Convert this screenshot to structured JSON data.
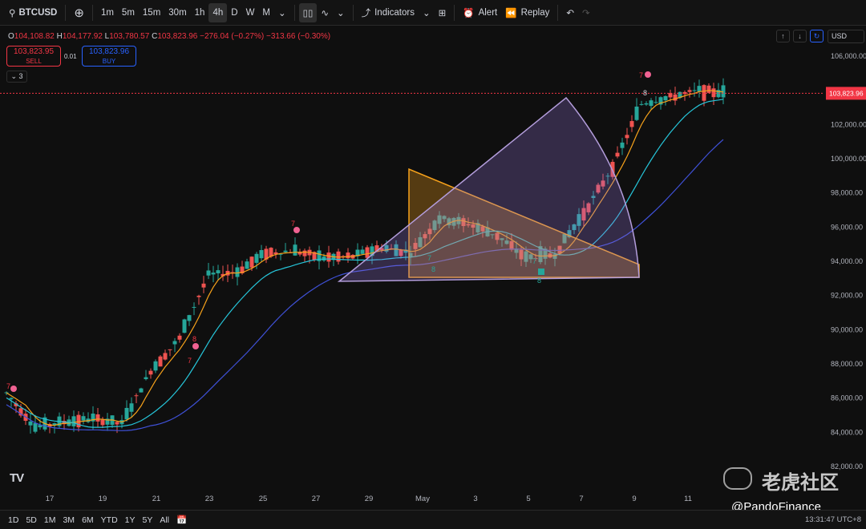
{
  "toolbar": {
    "symbol": "BTCUSD",
    "intervals": [
      "1m",
      "5m",
      "15m",
      "30m",
      "1h",
      "4h",
      "D",
      "W",
      "M"
    ],
    "active_interval": "4h",
    "indicators_label": "Indicators",
    "alert_label": "Alert",
    "replay_label": "Replay"
  },
  "ohlc": {
    "o": "104,108.82",
    "h": "104,177.92",
    "l": "103,780.57",
    "c": "103,823.96",
    "change": "−276.04 (−0.27%)",
    "change2": "−313.66 (−0.30%)"
  },
  "trade": {
    "sell_price": "103,823.95",
    "sell_label": "SELL",
    "spread": "0.01",
    "buy_price": "103,823.96",
    "buy_label": "BUY"
  },
  "collapse_count": "3",
  "currency": "USD",
  "price_axis": {
    "ticks": [
      "106,000.00",
      "104,000.00",
      "102,000.00",
      "100,000.00",
      "98,000.00",
      "96,000.00",
      "94,000.00",
      "92,000.00",
      "90,000.00",
      "88,000.00",
      "86,000.00",
      "84,000.00",
      "82,000.00"
    ],
    "current_price_label": "103,823.96",
    "current_price_color": "#f23645"
  },
  "time_axis": {
    "ticks": [
      "17",
      "19",
      "21",
      "23",
      "25",
      "27",
      "29",
      "May",
      "3",
      "5",
      "7",
      "9",
      "11"
    ]
  },
  "markers": {
    "left_top": "7",
    "apr21": "8",
    "apr21b": "7",
    "apr26": "7",
    "apr30_a": "7",
    "apr30_b": "8",
    "may5_a": "7",
    "may5_b": "8",
    "may9_a": "7",
    "may9_b": "8"
  },
  "bottom": {
    "ranges": [
      "1D",
      "5D",
      "1M",
      "3M",
      "6M",
      "YTD",
      "1Y",
      "5Y",
      "All"
    ],
    "clock": "13:31:47 UTC+8"
  },
  "watermark": {
    "cn_text": "老虎社区",
    "handle": "@PandoFinance"
  },
  "colors": {
    "up": "#26a69a",
    "down": "#ef5350",
    "ema_fast": "#f7a21b",
    "ema_mid": "#26c6da",
    "ema_slow": "#3f51d8",
    "triangle": "#f7a21b",
    "fan": "#b39ddb"
  },
  "chart_data": {
    "type": "candlestick",
    "symbol": "BTCUSD",
    "interval": "4h",
    "ylim": [
      82000,
      106000
    ],
    "x_labels": [
      "17",
      "19",
      "21",
      "23",
      "25",
      "27",
      "29",
      "May",
      "3",
      "5",
      "7",
      "9",
      "11"
    ],
    "close_path": [
      {
        "x": "16",
        "y": 86300
      },
      {
        "x": "17",
        "y": 84300
      },
      {
        "x": "18",
        "y": 84600
      },
      {
        "x": "19",
        "y": 84800
      },
      {
        "x": "20",
        "y": 84500
      },
      {
        "x": "21",
        "y": 87600
      },
      {
        "x": "22",
        "y": 89500
      },
      {
        "x": "23",
        "y": 93200
      },
      {
        "x": "24",
        "y": 93400
      },
      {
        "x": "25",
        "y": 94500
      },
      {
        "x": "26",
        "y": 94600
      },
      {
        "x": "27",
        "y": 94200
      },
      {
        "x": "28",
        "y": 94300
      },
      {
        "x": "29",
        "y": 94800
      },
      {
        "x": "30",
        "y": 94500
      },
      {
        "x": "May",
        "y": 96500
      },
      {
        "x": "3",
        "y": 96200
      },
      {
        "x": "4",
        "y": 95500
      },
      {
        "x": "5",
        "y": 94200
      },
      {
        "x": "6",
        "y": 94400
      },
      {
        "x": "7",
        "y": 96800
      },
      {
        "x": "8",
        "y": 99500
      },
      {
        "x": "9",
        "y": 103200
      },
      {
        "x": "10",
        "y": 103600
      },
      {
        "x": "11",
        "y": 104000
      },
      {
        "x": "12",
        "y": 103824
      }
    ],
    "last_price": 103823.96
  }
}
